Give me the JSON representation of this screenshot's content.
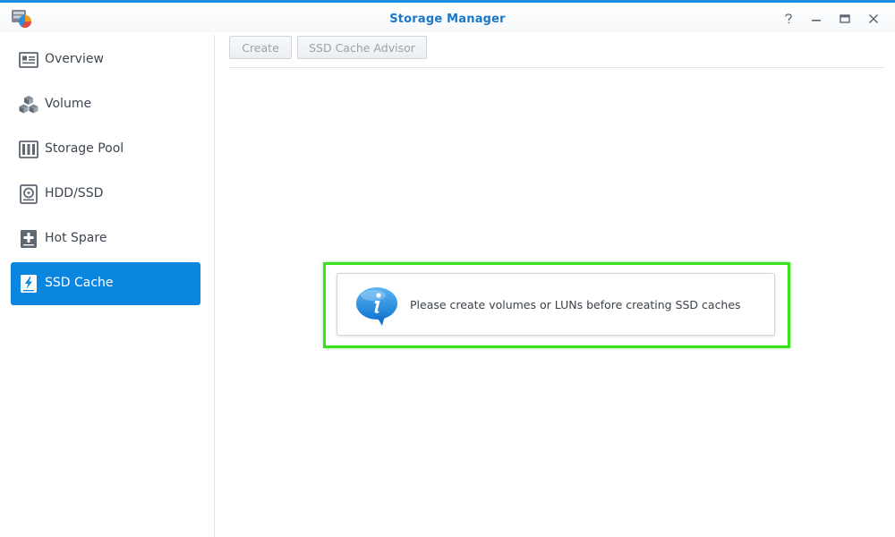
{
  "window": {
    "title": "Storage Manager",
    "accent_color": "#1a8fe0",
    "controls": [
      {
        "name": "help-icon"
      },
      {
        "name": "minimize-icon"
      },
      {
        "name": "maximize-icon"
      },
      {
        "name": "close-icon"
      }
    ]
  },
  "sidebar": {
    "active_color": "#0b86e0",
    "items": [
      {
        "label": "Overview",
        "icon": "overview-icon",
        "active": false
      },
      {
        "label": "Volume",
        "icon": "cubes-icon",
        "active": false
      },
      {
        "label": "Storage Pool",
        "icon": "storage-pool-icon",
        "active": false
      },
      {
        "label": "HDD/SSD",
        "icon": "hard-drive-icon",
        "active": false
      },
      {
        "label": "Hot Spare",
        "icon": "hot-spare-icon",
        "active": false
      },
      {
        "label": "SSD Cache",
        "icon": "ssd-cache-icon",
        "active": true
      }
    ]
  },
  "toolbar": {
    "create_label": "Create",
    "advisor_label": "SSD Cache Advisor"
  },
  "main": {
    "message": "Please create volumes or LUNs before creating SSD caches",
    "message_icon": "info-bubble-icon",
    "highlight_color": "#39e21c"
  }
}
